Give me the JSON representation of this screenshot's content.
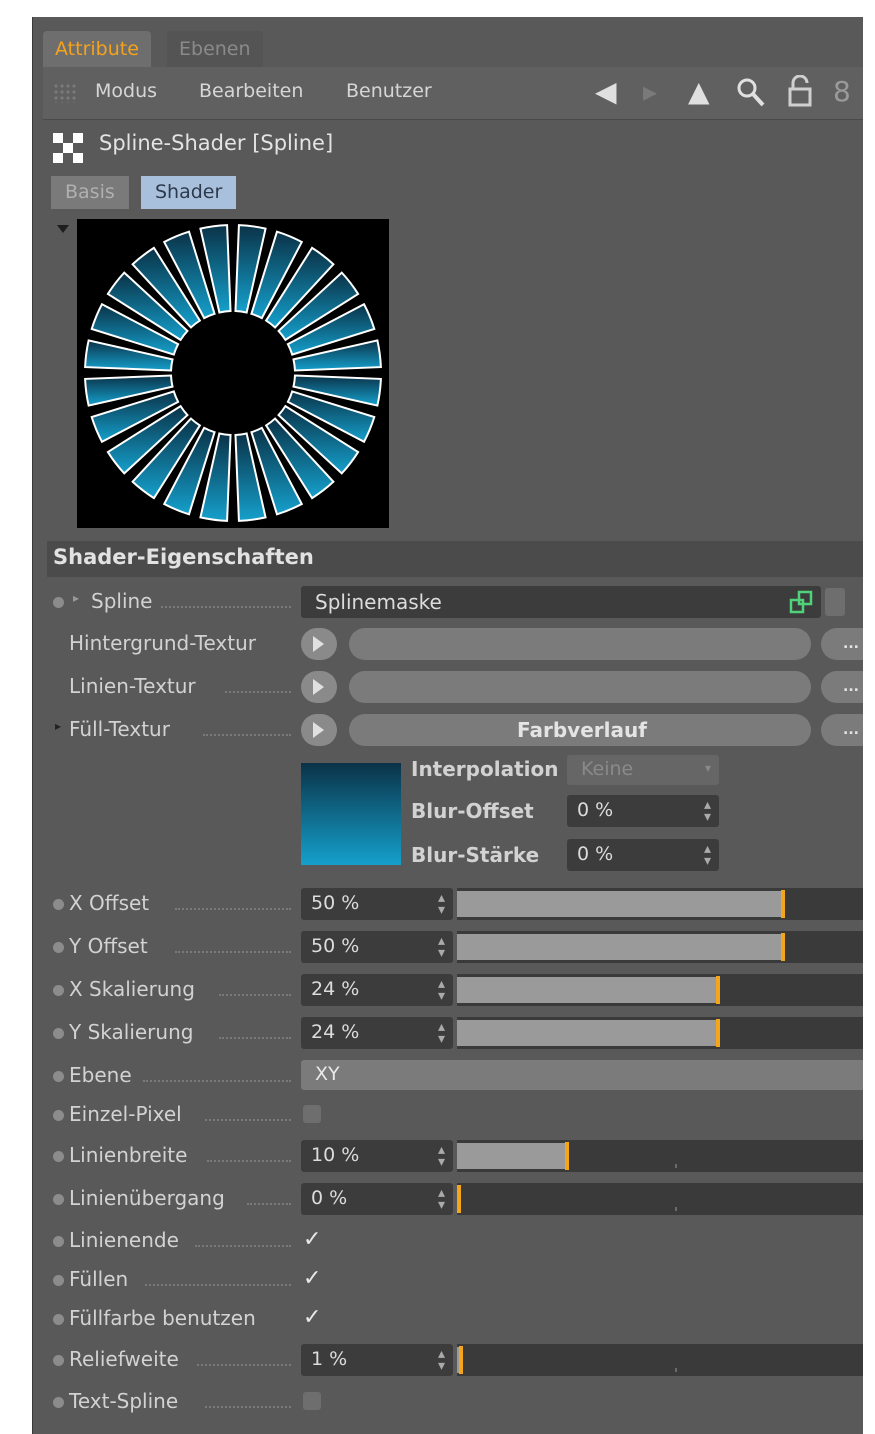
{
  "tabs": {
    "attribute": "Attribute",
    "ebenen": "Ebenen"
  },
  "menu": {
    "modus": "Modus",
    "bearbeiten": "Bearbeiten",
    "benutzer": "Benutzer"
  },
  "object": {
    "title": "Spline-Shader [Spline]"
  },
  "subtabs": {
    "basis": "Basis",
    "shader": "Shader"
  },
  "section": {
    "title": "Shader-Eigenschaften"
  },
  "spline": {
    "label": "Spline",
    "value": "Splinemaske"
  },
  "textures": {
    "hintergrund": "Hintergrund-Textur",
    "linien": "Linien-Textur",
    "fuell": "Füll-Textur",
    "fuell_value": "Farbverlauf",
    "more": "..."
  },
  "gradient": {
    "interpolation_label": "Interpolation",
    "interpolation_value": "Keine",
    "blur_offset_label": "Blur-Offset",
    "blur_offset_value": "0 %",
    "blur_staerke_label": "Blur-Stärke",
    "blur_staerke_value": "0 %"
  },
  "params": {
    "x_offset": {
      "label": "X Offset",
      "value": "50 %",
      "level": 0.5
    },
    "y_offset": {
      "label": "Y Offset",
      "value": "50 %",
      "level": 0.5
    },
    "x_skalierung": {
      "label": "X Skalierung",
      "value": "24 %",
      "level": 0.24
    },
    "y_skalierung": {
      "label": "Y Skalierung",
      "value": "24 %",
      "level": 0.24
    },
    "ebene": {
      "label": "Ebene",
      "value": "XY"
    },
    "einzel_pixel": {
      "label": "Einzel-Pixel",
      "checked": false
    },
    "linienbreite": {
      "label": "Linienbreite",
      "value": "10 %",
      "level": 0.1
    },
    "linienuebergang": {
      "label": "Linienübergang",
      "value": "0 %",
      "level": 0.0
    },
    "linienende": {
      "label": "Linienende",
      "checked": true
    },
    "fuellen": {
      "label": "Füllen",
      "checked": true
    },
    "fuellfarbe": {
      "label": "Füllfarbe benutzen",
      "checked": true
    },
    "reliefweite": {
      "label": "Reliefweite",
      "value": "1 %",
      "level": 0.01
    },
    "text_spline": {
      "label": "Text-Spline",
      "checked": false
    }
  },
  "colors": {
    "accent": "#f3a51c",
    "panel": "#595959",
    "field": "#3c3c3c",
    "gradient_top": "#0a3247",
    "gradient_bottom": "#15a0cc"
  },
  "icons": [
    "grip-icon",
    "arrow-left-icon",
    "arrow-up-icon",
    "search-icon",
    "lock-icon",
    "more-icon",
    "spline-shader-icon",
    "link-icon"
  ]
}
